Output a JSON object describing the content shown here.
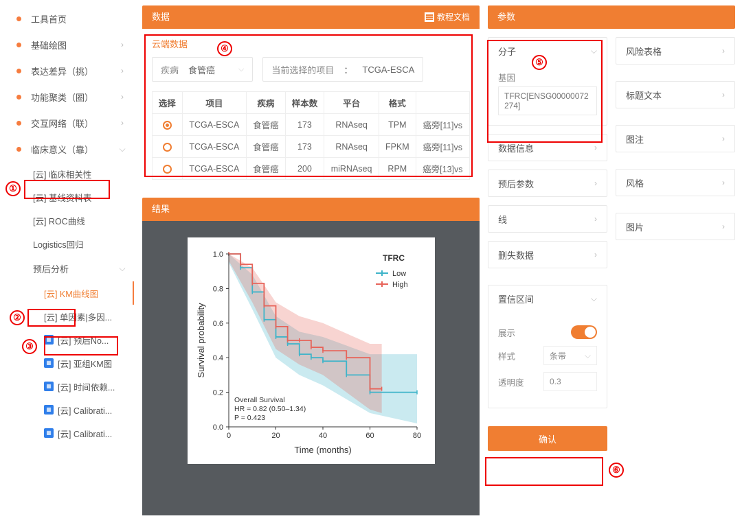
{
  "sidebar": {
    "home": "工具首页",
    "items": [
      {
        "label": "基础绘图",
        "chev": "›"
      },
      {
        "label": "表达差异（挑）",
        "chev": "›"
      },
      {
        "label": "功能聚类（圈）",
        "chev": "›"
      },
      {
        "label": "交互网络（联）",
        "chev": "›"
      }
    ],
    "clinical": {
      "label": "临床意义（靠）",
      "chev": "⌵"
    },
    "clinical_sub": [
      {
        "label": "[云] 临床相关性"
      },
      {
        "label": "[云] 基线资料表"
      },
      {
        "label": "[云] ROC曲线"
      },
      {
        "label": "Logistics回归"
      }
    ],
    "prognosis": {
      "label": "预后分析",
      "chev": "⌵"
    },
    "prognosis_sub": [
      {
        "label": "[云] KM曲线图",
        "active": true
      },
      {
        "label": "[云] 单因素|多因..."
      },
      {
        "label": "[云] 预后No...",
        "sq": true
      },
      {
        "label": "[云] 亚组KM图",
        "sq": true
      },
      {
        "label": "[云] 时间依赖...",
        "sq": true
      },
      {
        "label": "[云] Calibrati...",
        "sq": true
      },
      {
        "label": "[云] Calibrati...",
        "sq": true
      }
    ]
  },
  "data_panel": {
    "title": "数据",
    "doc_link": "教程文档",
    "cloud_title": "云端数据",
    "disease_label": "疾病",
    "disease_value": "食管癌",
    "project_label": "当前选择的项目",
    "project_value": "TCGA-ESCA",
    "cols": [
      "选择",
      "项目",
      "疾病",
      "样本数",
      "平台",
      "格式",
      ""
    ],
    "rows": [
      {
        "sel": true,
        "project": "TCGA-ESCA",
        "disease": "食管癌",
        "n": "173",
        "platform": "RNAseq",
        "format": "TPM",
        "extra": "癌旁[11]vs"
      },
      {
        "sel": false,
        "project": "TCGA-ESCA",
        "disease": "食管癌",
        "n": "173",
        "platform": "RNAseq",
        "format": "FPKM",
        "extra": "癌旁[11]vs"
      },
      {
        "sel": false,
        "project": "TCGA-ESCA",
        "disease": "食管癌",
        "n": "200",
        "platform": "miRNAseq",
        "format": "RPM",
        "extra": "癌旁[13]vs"
      }
    ]
  },
  "result_panel": {
    "title": "结果"
  },
  "param_panel": {
    "title": "参数",
    "molecule": {
      "head": "分子",
      "gene_label": "基因",
      "gene_value": "TFRC[ENSG00000072274]"
    },
    "left": [
      {
        "head": "数据信息"
      },
      {
        "head": "预后参数"
      },
      {
        "head": "线"
      },
      {
        "head": "删失数据"
      }
    ],
    "right": [
      {
        "head": "风险表格"
      },
      {
        "head": "标题文本"
      },
      {
        "head": "图注"
      },
      {
        "head": "风格"
      },
      {
        "head": "图片"
      }
    ],
    "ci": {
      "head": "置信区间",
      "show_label": "展示",
      "style_label": "样式",
      "style_value": "条带",
      "alpha_label": "透明度",
      "alpha_value": "0.3"
    },
    "confirm": "确认"
  },
  "chart_data": {
    "type": "line",
    "title": "TFRC",
    "legend": [
      "Low",
      "High"
    ],
    "xlabel": "Time (months)",
    "ylabel": "Survival probability",
    "xlim": [
      0,
      80
    ],
    "ylim": [
      0,
      1.0
    ],
    "xticks": [
      0,
      20,
      40,
      60,
      80
    ],
    "yticks": [
      0.0,
      0.2,
      0.4,
      0.6,
      0.8,
      1.0
    ],
    "annotations": [
      "Overall Survival",
      "HR = 0.82 (0.50–1.34)",
      "P = 0.423"
    ],
    "series": [
      {
        "name": "Low",
        "color": "#3fb4c9",
        "x": [
          0,
          5,
          10,
          15,
          20,
          25,
          30,
          35,
          40,
          50,
          60,
          80
        ],
        "y": [
          1.0,
          0.92,
          0.78,
          0.62,
          0.52,
          0.48,
          0.42,
          0.4,
          0.38,
          0.3,
          0.2,
          0.2
        ]
      },
      {
        "name": "High",
        "color": "#e7645a",
        "x": [
          0,
          5,
          10,
          15,
          20,
          25,
          30,
          35,
          40,
          50,
          60,
          65
        ],
        "y": [
          1.0,
          0.94,
          0.83,
          0.7,
          0.58,
          0.5,
          0.5,
          0.46,
          0.44,
          0.4,
          0.22,
          0.22
        ]
      }
    ],
    "ci_bands": [
      {
        "name": "Low",
        "color": "#3fb4c9",
        "x": [
          0,
          10,
          20,
          30,
          40,
          60,
          80
        ],
        "lo": [
          0.95,
          0.68,
          0.4,
          0.3,
          0.24,
          0.08,
          0.02
        ],
        "hi": [
          1.0,
          0.88,
          0.64,
          0.55,
          0.52,
          0.42,
          0.42
        ]
      },
      {
        "name": "High",
        "color": "#e7645a",
        "x": [
          0,
          10,
          20,
          30,
          40,
          60,
          65
        ],
        "lo": [
          0.96,
          0.72,
          0.45,
          0.36,
          0.3,
          0.1,
          0.08
        ],
        "hi": [
          1.0,
          0.92,
          0.72,
          0.64,
          0.6,
          0.48,
          0.48
        ]
      }
    ]
  },
  "annotations": {
    "1": "①",
    "2": "②",
    "3": "③",
    "4": "④",
    "5": "⑤",
    "6": "⑥"
  }
}
